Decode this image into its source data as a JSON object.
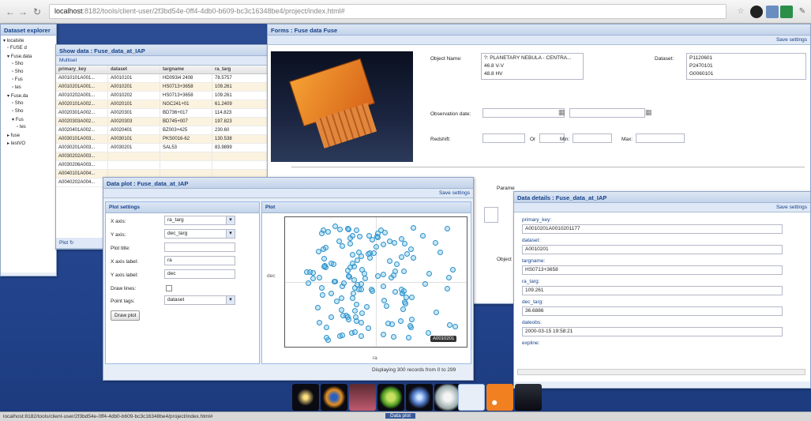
{
  "browser": {
    "url_host": "localhost",
    "url_rest": ":8182/tools/client-user/2f3bd54e-0ff4-4db0-b609-bc3c16348be4/project/index.html#"
  },
  "explorer": {
    "title": "Dataset explorer",
    "items": [
      "localsite",
      "FUSE d",
      "Fuse.data",
      "Sho",
      "Sho",
      "Fus",
      "tes",
      "Fuse.da",
      "Sho",
      "Sho",
      "Fus",
      "tes",
      "fuse",
      "testVO"
    ]
  },
  "show_data": {
    "title": "Show data : Fuse_data_at_IAP",
    "toolbar": "Multisel",
    "columns": [
      "primary_key",
      "dataset",
      "targname",
      "ra_targ"
    ],
    "rows": [
      [
        "A0010101A001...",
        "A0010101",
        "HD093i4 2408",
        "78.5757"
      ],
      [
        "A0010201A001...",
        "A0010201",
        "HS0713+3658",
        "109.261"
      ],
      [
        "A0010202A001...",
        "A0010202",
        "HS0713+3658",
        "109.261"
      ],
      [
        "A0020101A002...",
        "A0020101",
        "NGC241+01",
        "61.2409"
      ],
      [
        "A0020301A002...",
        "A0020301",
        "BD736+017",
        "114.823"
      ],
      [
        "A0020303A002...",
        "A0020303",
        "BD745+007",
        "197.823"
      ],
      [
        "A0020401A002...",
        "A0020401",
        "BZ003+425",
        "230.60"
      ],
      [
        "A0030101A003...",
        "A0030101",
        "PKS0016-62",
        "130.538"
      ],
      [
        "A0030201A003...",
        "A0030201",
        "SAL53",
        "83.9899"
      ],
      [
        "A0030202A003...",
        "",
        "",
        " "
      ],
      [
        "A0030206A003...",
        "",
        "",
        ""
      ],
      [
        "A0040101A004...",
        "",
        "",
        ""
      ],
      [
        "A0040202A004...",
        "",
        "",
        ""
      ]
    ],
    "footer": "Plot"
  },
  "forms": {
    "title": "Forms : Fuse data Fuse",
    "toolbar": "Save settings",
    "object_name_label": "Object Name:",
    "object_options": [
      "?: PLANETARY NEBULA - CENTRA...",
      "46.8 V-V",
      "48.8 HV"
    ],
    "dataset_label": "Dataset:",
    "dataset_options": [
      "P1120601",
      "P2470101",
      "G0060101"
    ],
    "observation_date_label": "Observation date:",
    "redshift_label": "Redshift:",
    "or_label": "Or",
    "min_label": "Min:",
    "max_label": "Max:",
    "params_label": "Parame",
    "object_label": "Object"
  },
  "data_plot": {
    "title": "Data plot : Fuse_data_at_IAP",
    "toolbar": "Save settings",
    "settings_header": "Plot settings",
    "plot_header": "Plot",
    "x_axis_label": "X axis:",
    "x_axis_value": "ra_targ",
    "y_axis_label": "Y axis:",
    "y_axis_value": "dec_targ",
    "plot_title_label": "Plot title:",
    "plot_title_value": "",
    "x_label_label": "X axis label:",
    "x_label_value": "ra",
    "y_label_label": "Y axis label:",
    "y_label_value": "dec",
    "draw_lines_label": "Draw lines:",
    "point_tags_label": "Point tags:",
    "point_tags_value": "dataset",
    "draw_button": "Draw plot",
    "tooltip": "A0010201",
    "y_axis_name": "dec",
    "x_axis_name": "ra",
    "status": "Displaying 300 records from 0 to 299"
  },
  "data_details": {
    "title": "Data details : Fuse_data_at_IAP",
    "toolbar": "Save settings",
    "fields": [
      {
        "label": "primary_key:",
        "value": "A0010201A0010201177"
      },
      {
        "label": "dataset:",
        "value": "A0010201"
      },
      {
        "label": "targname:",
        "value": "HS0713+3658"
      },
      {
        "label": "ra_targ:",
        "value": "109.261"
      },
      {
        "label": "dec_targ:",
        "value": "36.6886"
      },
      {
        "label": "dateobs:",
        "value": "2000-03-15 19:58:21"
      },
      {
        "label": "expline:",
        "value": ""
      }
    ]
  },
  "taskbar": {
    "text": "localhost:8182/tools/client-user/2f3bd54e-0ff4-4db0-b609-bc3c16348be4/project/index.html#",
    "tab": "Data plot"
  },
  "colors": {
    "accent": "#15428b",
    "desktop": "#22438c",
    "point": "#2f8fc9"
  }
}
